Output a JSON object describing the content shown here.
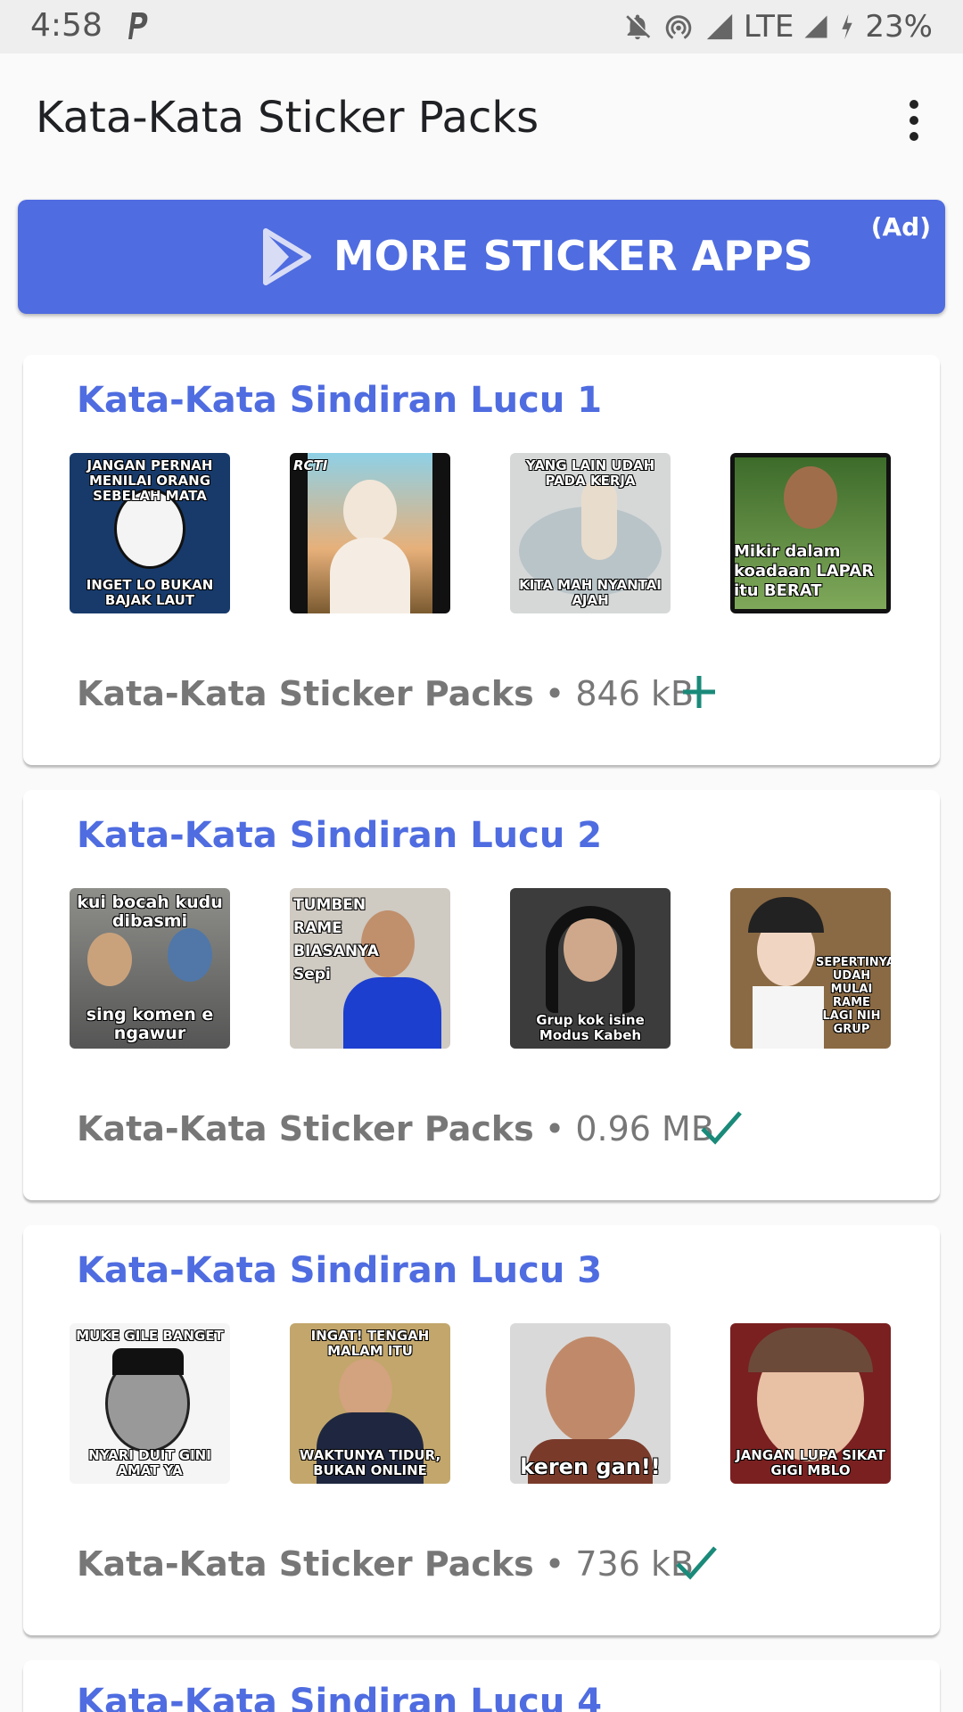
{
  "status": {
    "time": "4:58",
    "network": "LTE",
    "battery": "23%"
  },
  "app": {
    "title": "Kata-Kata Sticker Packs"
  },
  "ad": {
    "label": "MORE STICKER APPS",
    "tag": "(Ad)",
    "color": "#4f6ce0"
  },
  "packs": [
    {
      "title": "Kata-Kata Sindiran Lucu 1",
      "publisher": "Kata-Kata Sticker Packs",
      "size": "846 kB",
      "action": "add-icon",
      "stickers": [
        {
          "top": "JANGAN PERNAH MENILAI ORANG SEBELAH MATA",
          "bottom": "INGET LO BUKAN BAJAK LAUT"
        },
        {
          "top": "RCTI",
          "bottom": ""
        },
        {
          "top": "YANG LAIN UDAH PADA KERJA",
          "bottom": "KITA MAH NYANTAI AJAH"
        },
        {
          "top": "Mikir dalam koadaan LAPAR itu BERAT",
          "bottom": ""
        }
      ]
    },
    {
      "title": "Kata-Kata Sindiran Lucu 2",
      "publisher": "Kata-Kata Sticker Packs",
      "size": "0.96 MB",
      "action": "check-icon",
      "stickers": [
        {
          "top": "kui bocah kudu dibasmi",
          "bottom": "sing komen e ngawur"
        },
        {
          "top": "TUMBEN RAME BIASANYA Sepi",
          "bottom": ""
        },
        {
          "top": "",
          "bottom": "Grup kok isine Modus Kabeh"
        },
        {
          "top": "",
          "bottom": "SEPERTINYA UDAH MULAI RAME LAGI NIH GRUP"
        }
      ]
    },
    {
      "title": "Kata-Kata Sindiran Lucu 3",
      "publisher": "Kata-Kata Sticker Packs",
      "size": "736 kB",
      "action": "check-icon",
      "stickers": [
        {
          "top": "MUKE GILE BANGET",
          "bottom": "NYARI DUIT GINI AMAT YA"
        },
        {
          "top": "INGAT! TENGAH MALAM ITU",
          "bottom": "WAKTUNYA TIDUR, BUKAN ONLINE"
        },
        {
          "top": "",
          "bottom": "keren gan!!"
        },
        {
          "top": "",
          "bottom": "JANGAN LUPA SIKAT GIGI MBLO"
        }
      ]
    },
    {
      "title": "Kata-Kata Sindiran Lucu 4"
    }
  ],
  "colors": {
    "accent": "#4f6ce0",
    "action": "#1a8a7a",
    "meta": "#777777"
  }
}
